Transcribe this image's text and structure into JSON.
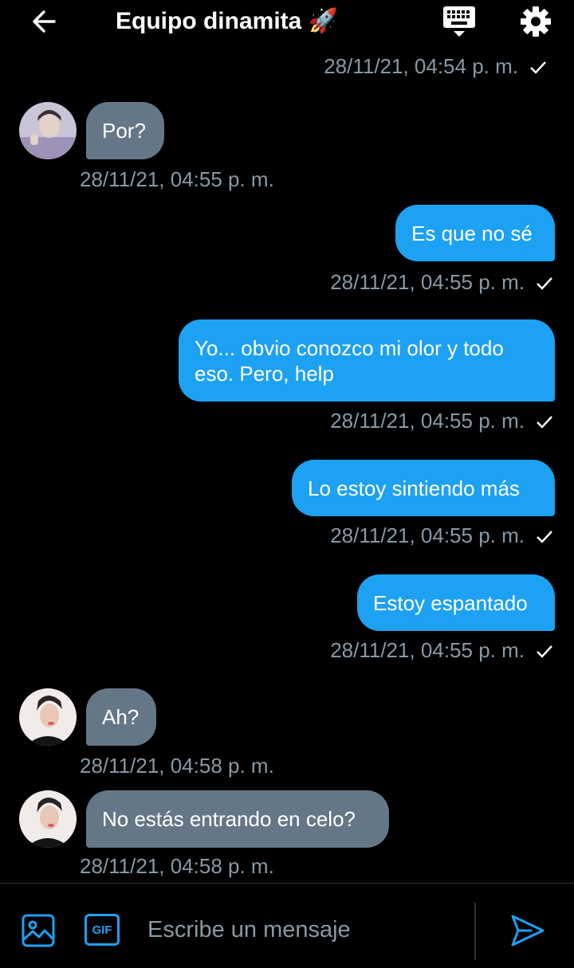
{
  "header": {
    "title": "Equipo dinamita 🚀",
    "back_icon": "arrow-left-icon",
    "keyboard_icon": "keyboard-icon",
    "settings_icon": "gear-icon"
  },
  "messages": [
    {
      "direction": "out",
      "text": "",
      "timestamp": "28/11/21, 04:54 p. m."
    },
    {
      "direction": "in",
      "text": "Por?",
      "timestamp": "28/11/21, 04:55 p. m."
    },
    {
      "direction": "out",
      "text": "Es que no sé",
      "timestamp": "28/11/21, 04:55 p. m."
    },
    {
      "direction": "out",
      "text": "Yo... obvio conozco mi olor y todo eso. Pero, help",
      "timestamp": "28/11/21, 04:55 p. m."
    },
    {
      "direction": "out",
      "text": "Lo estoy sintiendo más",
      "timestamp": "28/11/21, 04:55 p. m."
    },
    {
      "direction": "out",
      "text": "Estoy espantado",
      "timestamp": "28/11/21, 04:55 p. m."
    },
    {
      "direction": "in",
      "text": "Ah?",
      "timestamp": "28/11/21, 04:58 p. m."
    },
    {
      "direction": "in",
      "text": "No estás entrando en celo?",
      "timestamp": "28/11/21, 04:58 p. m."
    }
  ],
  "composer": {
    "placeholder": "Escribe un mensaje",
    "image_icon": "image-icon",
    "gif_label": "GIF",
    "send_icon": "send-icon"
  },
  "colors": {
    "background": "#000000",
    "outgoing_bubble": "#1da1f2",
    "incoming_bubble": "#657786",
    "timestamp": "#8899a6",
    "accent": "#1da1f2"
  }
}
